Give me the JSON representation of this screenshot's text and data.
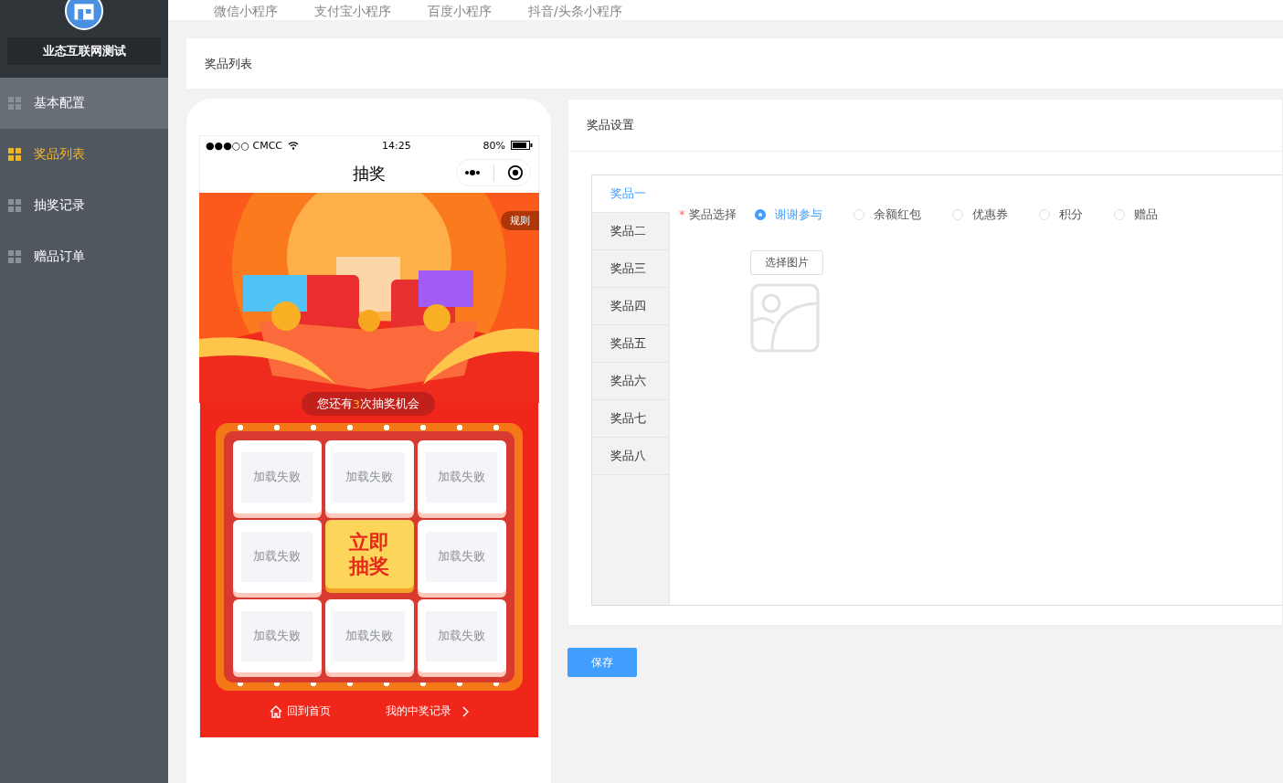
{
  "sidebar": {
    "brand": "业态互联网测试",
    "items": [
      {
        "label": "基本配置",
        "selected": false,
        "highlighted": true
      },
      {
        "label": "奖品列表",
        "selected": true,
        "highlighted": false
      },
      {
        "label": "抽奖记录",
        "selected": false,
        "highlighted": false
      },
      {
        "label": "赠品订单",
        "selected": false,
        "highlighted": false
      }
    ]
  },
  "top_tabs": [
    {
      "label": "微信小程序"
    },
    {
      "label": "支付宝小程序"
    },
    {
      "label": "百度小程序"
    },
    {
      "label": "抖音/头条小程序"
    }
  ],
  "page_title": "奖品列表",
  "phone": {
    "status": {
      "carrier": "●●●○○ CMCC",
      "time": "14:25",
      "battery": "80%"
    },
    "title": "抽奖",
    "rules": "规则",
    "chances": {
      "before": "您还有",
      "count": "3",
      "after": "次抽奖机会"
    },
    "board_rows": [
      {
        "cells": [
          {
            "kind": "prize",
            "text": "加载失败"
          },
          {
            "kind": "prize",
            "text": "加载失败"
          },
          {
            "kind": "prize",
            "text": "加载失败"
          }
        ]
      },
      {
        "cells": [
          {
            "kind": "prize",
            "text": "加载失败"
          },
          {
            "kind": "start",
            "text": "立即抽奖"
          },
          {
            "kind": "prize",
            "text": "加载失败"
          }
        ]
      },
      {
        "cells": [
          {
            "kind": "prize",
            "text": "加载失败"
          },
          {
            "kind": "prize",
            "text": "加载失败"
          },
          {
            "kind": "prize",
            "text": "加载失败"
          }
        ]
      }
    ],
    "footer": {
      "home": "回到首页",
      "records": "我的中奖记录"
    }
  },
  "settings": {
    "title": "奖品设置",
    "prize_tabs": [
      {
        "label": "奖品一",
        "selected": true
      },
      {
        "label": "奖品二",
        "selected": false
      },
      {
        "label": "奖品三",
        "selected": false
      },
      {
        "label": "奖品四",
        "selected": false
      },
      {
        "label": "奖品五",
        "selected": false
      },
      {
        "label": "奖品六",
        "selected": false
      },
      {
        "label": "奖品七",
        "selected": false
      },
      {
        "label": "奖品八",
        "selected": false
      }
    ],
    "field_label": "奖品选择",
    "required_mark": "*",
    "options": [
      {
        "label": "谢谢参与",
        "selected": true
      },
      {
        "label": "余额红包",
        "selected": false
      },
      {
        "label": "优惠券",
        "selected": false
      },
      {
        "label": "积分",
        "selected": false
      },
      {
        "label": "赠品",
        "selected": false
      }
    ],
    "image_button": "选择图片"
  },
  "save_button": "保存"
}
